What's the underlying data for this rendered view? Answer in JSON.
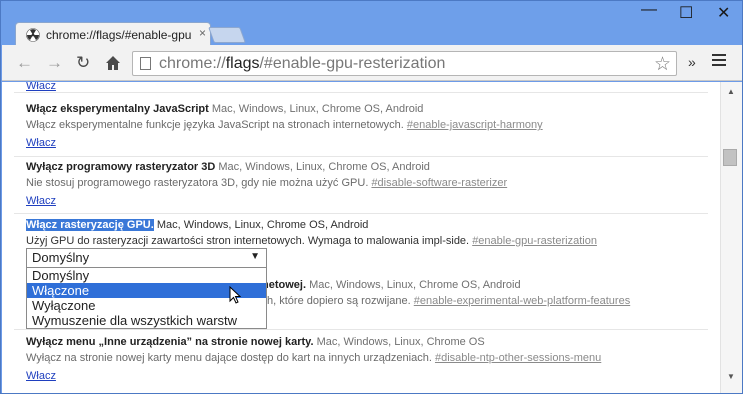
{
  "window": {
    "controls": {
      "minimize_icon": "minimize-icon",
      "maximize_icon": "maximize-icon",
      "close_icon": "close-icon"
    }
  },
  "tab": {
    "title": "chrome://flags/#enable-gpu",
    "close": "×"
  },
  "toolbar": {
    "url_prefix": "chrome://",
    "url_host": "flags",
    "url_rest": "/#enable-gpu-resterization",
    "extensions_chevron": "»"
  },
  "content": {
    "top_link": "Włacz",
    "entries": [
      {
        "title": "Włącz eksperymentalny JavaScript",
        "platforms": "Mac, Windows, Linux, Chrome OS, Android",
        "description": "Włącz eksperymentalne funkcje języka JavaScript na stronach internetowych.",
        "anchor": "#enable-javascript-harmony",
        "link": "Włacz"
      },
      {
        "title": "Wyłącz programowy rasteryzator 3D",
        "platforms": "Mac, Windows, Linux, Chrome OS, Android",
        "description": "Nie stosuj programowego rasteryzatora 3D, gdy nie można użyć GPU.",
        "anchor": "#disable-software-rasterizer",
        "link": "Włacz"
      },
      {
        "title": "Włącz rasteryzację GPU.",
        "platforms": "Mac, Windows, Linux, Chrome OS, Android",
        "description": "Użyj GPU do rasteryzacji zawartości stron internetowych. Wymaga to malowania impl-side.",
        "anchor": "#enable-gpu-rasterization",
        "select_value": "Domyślny",
        "options": [
          "Domyślny",
          "Włączone",
          "Wyłączone",
          "Wymuszenie dla wszystkich warstw"
        ],
        "selected_option_index": 1
      },
      {
        "title_tail": "netowej.",
        "platforms": "Mac, Windows, Linux, Chrome OS, Android",
        "description_tail": "h, które dopiero są rozwijane.",
        "anchor": "#enable-experimental-web-platform-features"
      },
      {
        "title": "Wyłącz menu „Inne urządzenia” na stronie nowej karty.",
        "platforms": "Mac, Windows, Linux, Chrome OS",
        "description": "Wyłącz na stronie nowej karty menu dające dostęp do kart na innych urządzeniach.",
        "anchor": "#disable-ntp-other-sessions-menu",
        "link": "Włacz"
      }
    ]
  }
}
